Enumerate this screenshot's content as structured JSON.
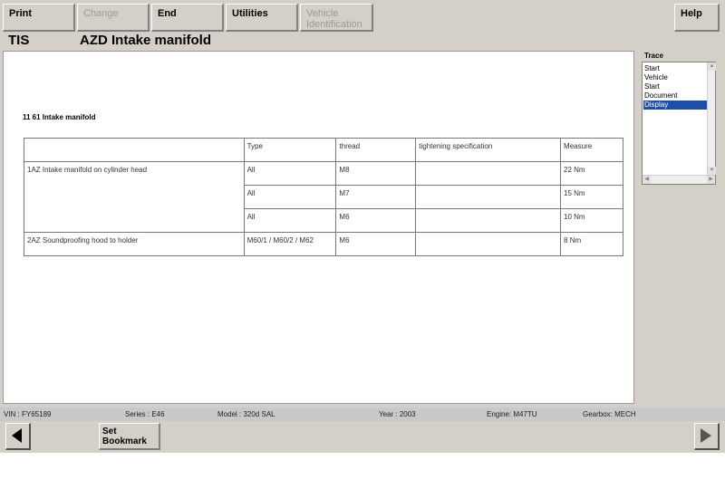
{
  "toolbar": {
    "print": "Print",
    "change": "Change",
    "end": "End",
    "utilities": "Utilities",
    "vehicle_id_line1": "Vehicle",
    "vehicle_id_line2": "Identification",
    "help": "Help"
  },
  "header": {
    "app": "TIS",
    "document_title": "AZD  Intake manifold"
  },
  "document": {
    "section_title": "11 61 Intake manifold",
    "table": {
      "headers": [
        "",
        "Type",
        "thread",
        "tightening specification",
        "Measure"
      ],
      "rows": [
        {
          "item": "1AZ  Intake manifold on cylinder head",
          "type": "All",
          "thread": "M8",
          "spec": "",
          "measure": "22 Nm"
        },
        {
          "item": "",
          "type": "All",
          "thread": "M7",
          "spec": "",
          "measure": "15 Nm"
        },
        {
          "item": "",
          "type": "All",
          "thread": "M6",
          "spec": "",
          "measure": "10 Nm"
        },
        {
          "item": "2AZ  Soundproofing hood to holder",
          "type": "M60/1 / M60/2 / M62",
          "thread": "M6",
          "spec": "",
          "measure": "8 Nm"
        }
      ]
    }
  },
  "trace": {
    "label": "Trace",
    "items": [
      "Start",
      "Vehicle",
      "Start",
      "Document",
      "Display"
    ],
    "selected_index": 4
  },
  "vehicle_info": {
    "vin": "VIN : FY65189",
    "series": "Series : E46",
    "model": "Model : 320d SAL",
    "year": "Year : 2003",
    "engine": "Engine: M47TU",
    "gearbox": "Gearbox: MECH"
  },
  "nav": {
    "bookmark_line1": "Set",
    "bookmark_line2": "Bookmark"
  },
  "colors": {
    "background": "#d4d0c8",
    "selection": "#1e4fa8",
    "disabled_text": "#9a9a9a"
  }
}
